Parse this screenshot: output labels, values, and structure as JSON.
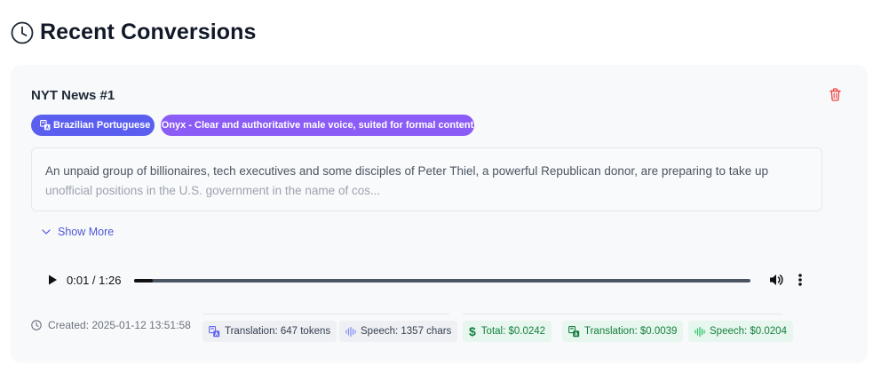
{
  "header": {
    "title": "Recent Conversions",
    "icon": "clock-icon"
  },
  "conversion": {
    "title": "NYT News #1",
    "language_badge": "Brazilian Portuguese",
    "voice_badge": "Onyx - Clear and authoritative male voice, suited for formal content",
    "text_line1": "An unpaid group of billionaires, tech executives and some disciples of Peter Thiel, a powerful Republican donor, are preparing to take up",
    "text_line2": "unofficial positions in the U.S. government in the name of cos...",
    "show_more_label": "Show More",
    "audio": {
      "time_display": "0:01 / 1:26",
      "progress": 0.03
    },
    "created": "Created: 2025-01-12 13:51:58",
    "usage": {
      "translation_tokens": "Translation: 647 tokens",
      "speech_chars": "Speech: 1357 chars"
    },
    "cost": {
      "total": "Total: $0.0242",
      "translation": "Translation: $0.0039",
      "speech": "Speech: $0.0204"
    }
  },
  "colors": {
    "language_badge": "#5b5ff0",
    "voice_badge": "#8b5cf6",
    "delete": "#ef4444",
    "link": "#4f56d8",
    "cost_text": "#15803d"
  }
}
